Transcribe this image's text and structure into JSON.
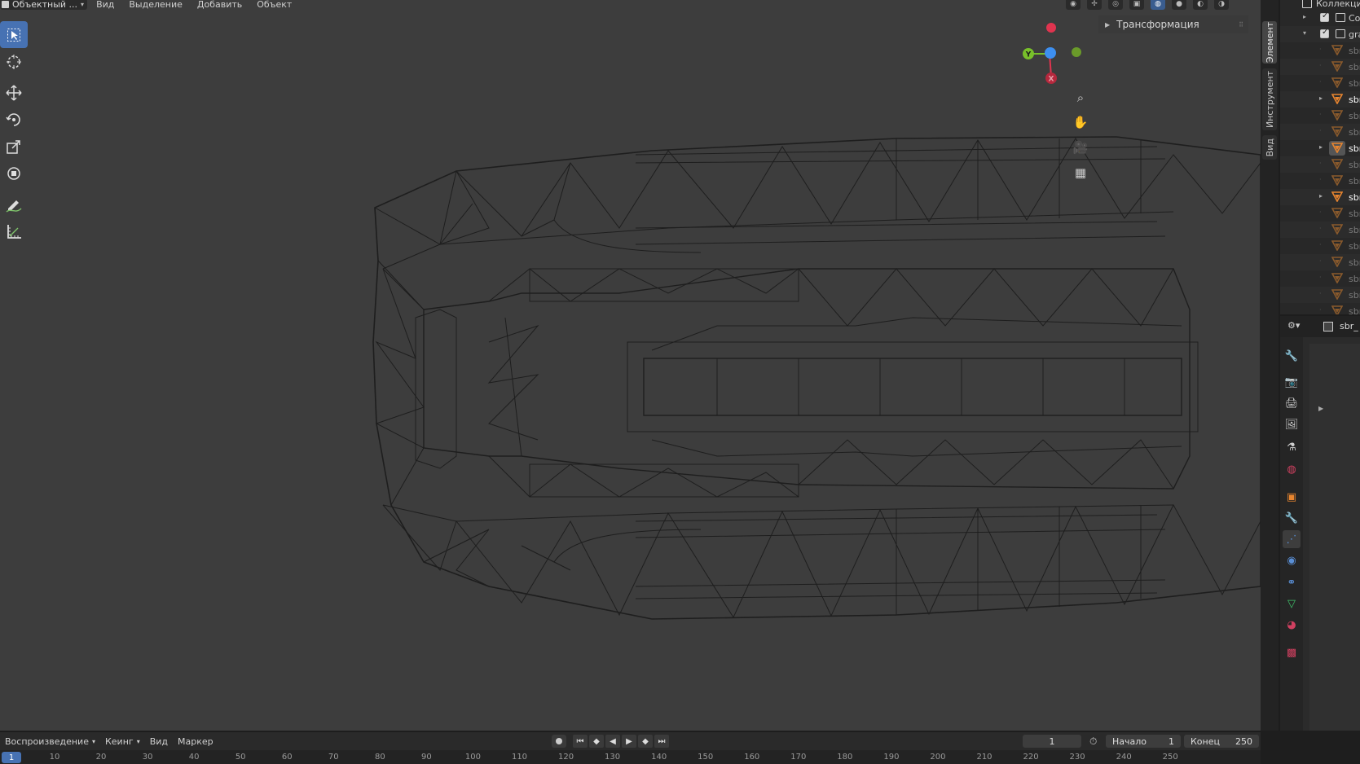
{
  "viewport_header": {
    "mode": "Объектный ...",
    "menus": [
      "Вид",
      "Выделение",
      "Добавить",
      "Объект"
    ]
  },
  "npanel": {
    "transform_label": "Трансформация",
    "tabs": [
      "Элемент",
      "Инструмент",
      "Вид"
    ]
  },
  "gizmo": {
    "y_label": "Y",
    "x_label": "X",
    "colors": {
      "x": "#e0344f",
      "y": "#78c02a",
      "z": "#3d8ff0"
    }
  },
  "outliner": {
    "header": "Коллекци",
    "rows": [
      {
        "name": "Co",
        "type": "collection",
        "expander": "▸",
        "checked": true
      },
      {
        "name": "gra",
        "type": "collection",
        "expander": "▾",
        "checked": true
      },
      {
        "name": "sbr",
        "type": "mesh",
        "state": "dim"
      },
      {
        "name": "sbr",
        "type": "mesh",
        "state": "dim"
      },
      {
        "name": "sbr",
        "type": "mesh",
        "state": "dim"
      },
      {
        "name": "sbr",
        "type": "mesh",
        "state": "bright"
      },
      {
        "name": "sbr",
        "type": "mesh",
        "state": "dim"
      },
      {
        "name": "sbr",
        "type": "mesh",
        "state": "dim"
      },
      {
        "name": "sbr",
        "type": "mesh",
        "state": "selected"
      },
      {
        "name": "sbr",
        "type": "mesh",
        "state": "dim"
      },
      {
        "name": "sbr",
        "type": "mesh",
        "state": "dim"
      },
      {
        "name": "sbr",
        "type": "mesh",
        "state": "bright"
      },
      {
        "name": "sbr",
        "type": "mesh",
        "state": "dim"
      },
      {
        "name": "sbr",
        "type": "mesh",
        "state": "dim"
      },
      {
        "name": "sbr",
        "type": "mesh",
        "state": "dim"
      },
      {
        "name": "sbr",
        "type": "mesh",
        "state": "dim"
      },
      {
        "name": "sbr",
        "type": "mesh",
        "state": "dim"
      },
      {
        "name": "sbr",
        "type": "mesh",
        "state": "dim"
      },
      {
        "name": "sbr",
        "type": "mesh",
        "state": "dim"
      }
    ]
  },
  "properties": {
    "object_name": "sbr_",
    "tabs": [
      "tool",
      "render",
      "output",
      "view-layer",
      "scene",
      "world",
      "object",
      "modifiers",
      "particles",
      "physics",
      "constraints",
      "data",
      "material",
      "texture"
    ]
  },
  "timeline": {
    "menus": [
      "Воспроизведение",
      "Кеинг",
      "Вид",
      "Маркер"
    ],
    "current_frame": "1",
    "start_label": "Начало",
    "start_value": "1",
    "end_label": "Конец",
    "end_value": "250",
    "cursor_frame": "1",
    "ruler_labels": [
      "10",
      "20",
      "30",
      "40",
      "50",
      "60",
      "70",
      "80",
      "90",
      "100",
      "110",
      "120",
      "130",
      "140",
      "150",
      "160",
      "170",
      "180",
      "190",
      "200",
      "210",
      "220",
      "230",
      "240",
      "250"
    ]
  },
  "accent_color": "#4772b3"
}
